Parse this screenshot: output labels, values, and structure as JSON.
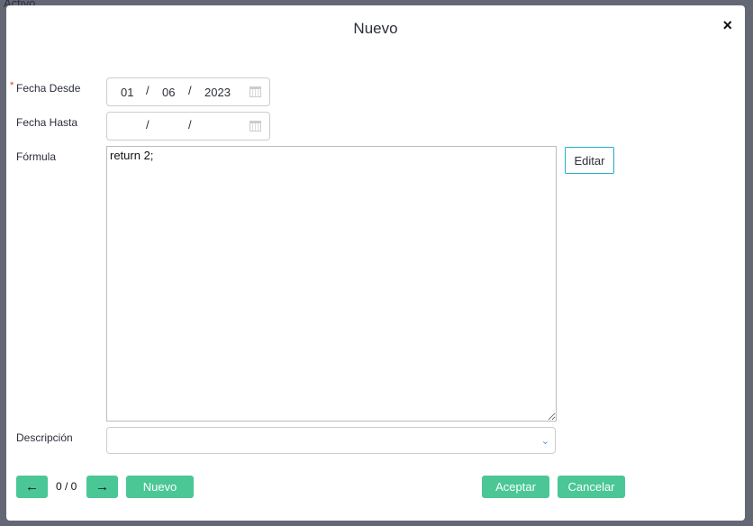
{
  "background": {
    "text": "Activo"
  },
  "modal": {
    "title": "Nuevo",
    "close_icon": "×"
  },
  "form": {
    "fecha_desde": {
      "label": "Fecha Desde",
      "required": "*",
      "day": "01",
      "month": "06",
      "year": "2023",
      "sep": "/"
    },
    "fecha_hasta": {
      "label": "Fecha Hasta",
      "sep": "/"
    },
    "formula": {
      "label": "Fórmula",
      "value": "return 2;",
      "edit_label": "Editar"
    },
    "descripcion": {
      "label": "Descripción",
      "value": ""
    }
  },
  "footer": {
    "counter": "0 / 0",
    "prev_icon": "←",
    "next_icon": "→",
    "nuevo": "Nuevo",
    "aceptar": "Aceptar",
    "cancelar": "Cancelar"
  },
  "colors": {
    "primary": "#4ac795",
    "overlay": "#646875"
  }
}
